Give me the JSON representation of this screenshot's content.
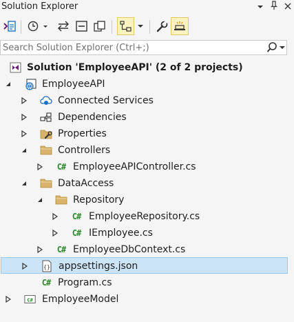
{
  "title": "Solution Explorer",
  "window_controls": {
    "dropdown": "▾",
    "pin": "ᵖ",
    "close": "×"
  },
  "search": {
    "placeholder": "Search Solution Explorer (Ctrl+;)"
  },
  "tree": {
    "solution": "Solution 'EmployeeAPI' (2 of 2 projects)",
    "project1": "EmployeeAPI",
    "connected": "Connected Services",
    "dependencies": "Dependencies",
    "properties": "Properties",
    "controllers": "Controllers",
    "controller_file": "EmployeeAPIController.cs",
    "dataaccess": "DataAccess",
    "repository": "Repository",
    "repo_file": "EmployeeRepository.cs",
    "iemployee_file": "IEmployee.cs",
    "dbcontext_file": "EmployeeDbContext.cs",
    "appsettings": "appsettings.json",
    "program": "Program.cs",
    "project2": "EmployeeModel"
  },
  "csharp_glyph": "C#",
  "colors": {
    "accent_blue": "#1e6fc6",
    "folder": "#d7b46a",
    "csharp_green": "#2c8b2c",
    "selected_row": "#cce4f7"
  }
}
